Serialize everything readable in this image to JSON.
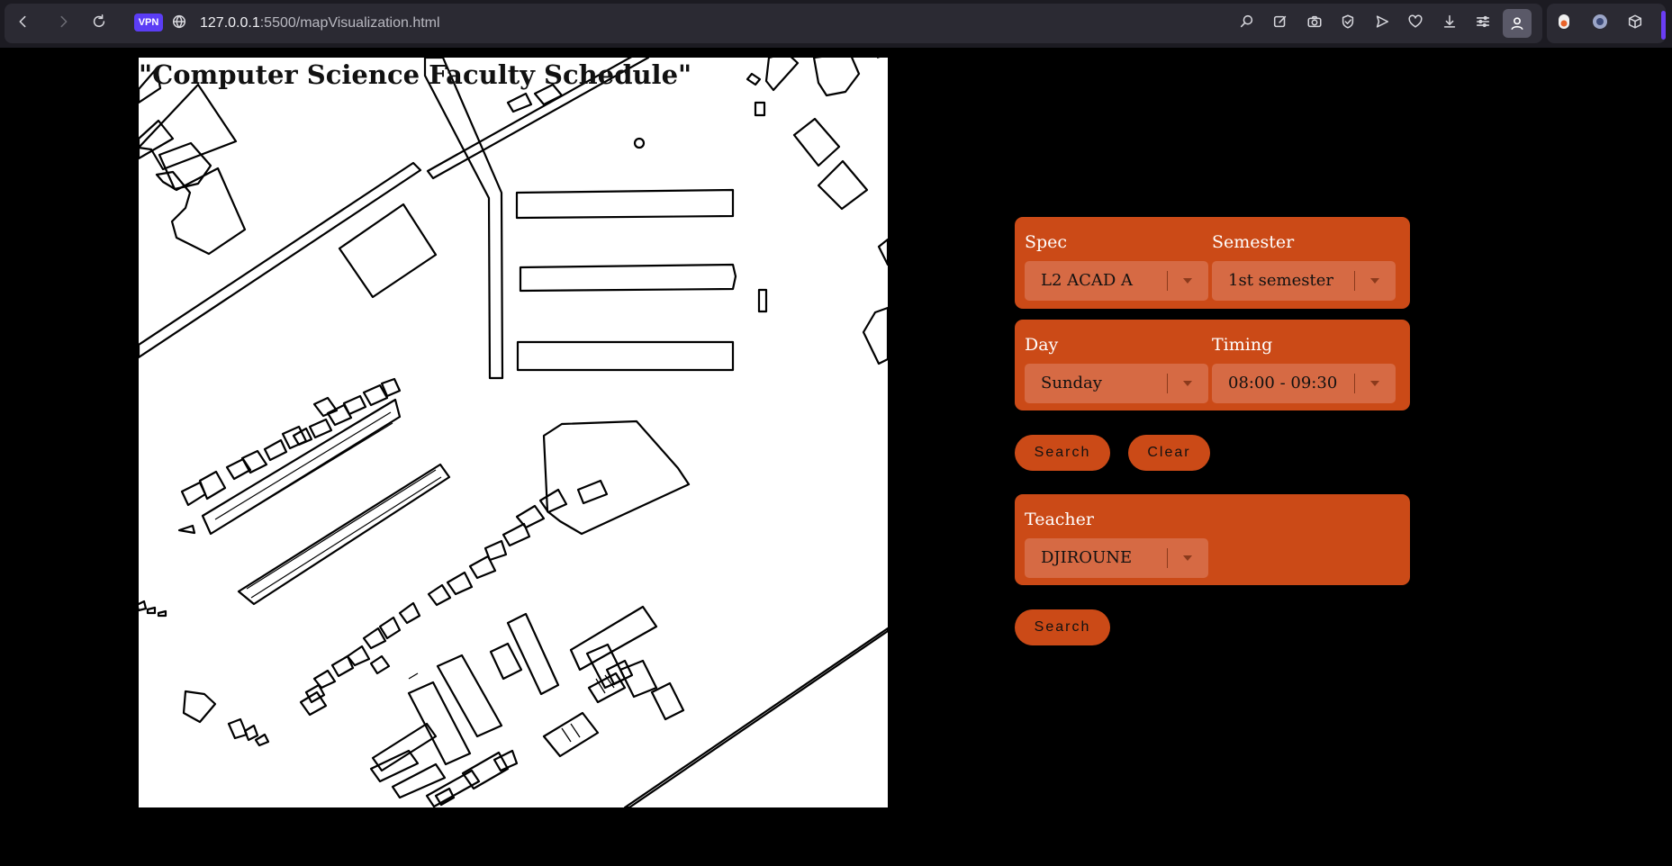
{
  "browser": {
    "vpn_badge": "VPN",
    "url_host": "127.0.0.1",
    "url_path": ":5500/mapVisualization.html",
    "nav_icons": [
      "back-icon",
      "forward-icon",
      "reload-icon",
      "site-info-icon"
    ],
    "toolbar_icons": [
      "search-page-icon",
      "edit-icon",
      "camera-icon",
      "shield-icon",
      "send-icon",
      "heart-icon",
      "download-icon",
      "menu-settings-icon",
      "profile-icon"
    ],
    "extension_icons": [
      "extension-1-icon",
      "extension-2-icon",
      "extension-3-icon"
    ]
  },
  "map": {
    "title": "\"Computer Science Faculty Schedule\""
  },
  "schedule_form": {
    "spec": {
      "label": "Spec",
      "selected": "L2 ACAD A"
    },
    "semester": {
      "label": "Semester",
      "selected": "1st semester"
    },
    "day": {
      "label": "Day",
      "selected": "Sunday"
    },
    "timing": {
      "label": "Timing",
      "selected": "08:00 - 09:30"
    },
    "search_label": "Search",
    "clear_label": "Clear"
  },
  "teacher_form": {
    "teacher": {
      "label": "Teacher",
      "selected": "DJIROUNE"
    },
    "search_label": "Search"
  },
  "colors": {
    "accent": "#cb4a17",
    "select_bg": "#d66a44",
    "page_bg": "#000000",
    "vpn": "#5b3df5"
  }
}
